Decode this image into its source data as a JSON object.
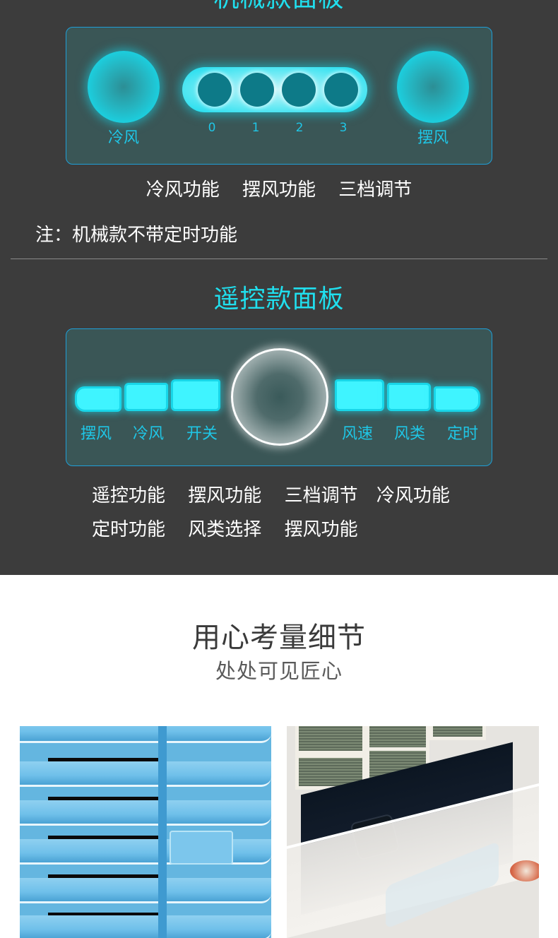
{
  "mechanical_section": {
    "title": "机械款面板",
    "panel": {
      "left_button_label": "冷风",
      "right_button_label": "摆风",
      "speed_levels": [
        "0",
        "1",
        "2",
        "3"
      ]
    },
    "features": [
      "冷风功能",
      "摆风功能",
      "三档调节"
    ],
    "note": "注：机械款不带定时功能"
  },
  "remote_section": {
    "title": "遥控款面板",
    "panel": {
      "left_keys": [
        "摆风",
        "冷风",
        "开关"
      ],
      "right_keys": [
        "风速",
        "风类",
        "定时"
      ]
    },
    "features_row1": [
      "遥控功能",
      "摆风功能",
      "三档调节",
      "冷风功能"
    ],
    "features_row2": [
      "定时功能",
      "风类选择",
      "摆风功能"
    ]
  },
  "detail_section": {
    "title": "用心考量细节",
    "subtitle": "处处可见匠心",
    "photos": [
      {
        "subject": "blue air louvers close-up"
      },
      {
        "subject": "water tank drawer with filter"
      }
    ]
  },
  "colors": {
    "accent_cyan": "#20dfee",
    "label_cyan": "#1fc6e6",
    "panel_border": "#1f9fd8",
    "dark_bg": "#3c3c3c"
  }
}
